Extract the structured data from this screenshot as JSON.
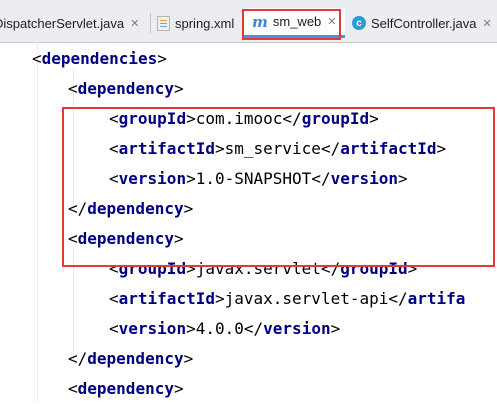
{
  "tabs": [
    {
      "label": "DispatcherServlet.java",
      "icon": "java-class-icon",
      "active": false
    },
    {
      "label": "spring.xml",
      "icon": "xml-file-icon",
      "active": false
    },
    {
      "label": "sm_web",
      "icon": "maven-m-icon",
      "active": true
    },
    {
      "label": "SelfController.java",
      "icon": "java-class-icon",
      "active": false
    }
  ],
  "colors": {
    "tag": "#000080",
    "text": "#000000",
    "highlight_box": "#e53935",
    "active_tab_underline": "#4a90e2"
  },
  "code": {
    "lines": [
      {
        "tag": "dependencies",
        "closing": false
      },
      {
        "tag": "dependency",
        "closing": false
      },
      {
        "tag": "groupId",
        "value": "com.imooc"
      },
      {
        "tag": "artifactId",
        "value": "sm_service"
      },
      {
        "tag": "version",
        "value": "1.0-SNAPSHOT"
      },
      {
        "tag": "dependency",
        "closing": true
      },
      {
        "tag": "dependency",
        "closing": false
      },
      {
        "tag": "groupId",
        "value": "javax.servlet"
      },
      {
        "tag": "artifactId",
        "value": "javax.servlet-api",
        "cut_tag": "artifa"
      },
      {
        "tag": "version",
        "value": "4.0.0"
      },
      {
        "tag": "dependency",
        "closing": true
      },
      {
        "tag": "dependency",
        "closing": false
      }
    ]
  }
}
